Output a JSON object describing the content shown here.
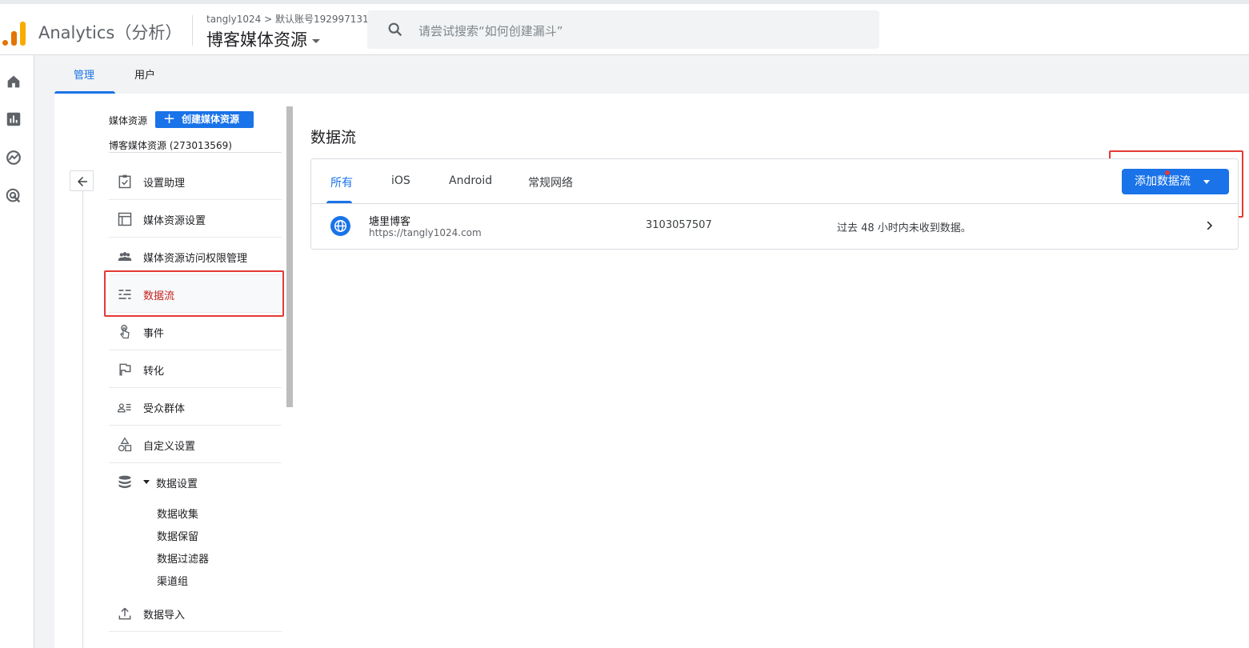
{
  "header": {
    "app_title": "Analytics（分析）",
    "account_crumb": "tangly1024 > 默认账号192997131",
    "property_name": "博客媒体资源",
    "search_placeholder": "请尝试搜索“如何创建漏斗”"
  },
  "rail": {
    "icons": [
      "home-icon",
      "reports-icon",
      "explore-icon",
      "advertising-icon"
    ]
  },
  "admin_tabs": {
    "items": [
      {
        "label": "管理",
        "active": true
      },
      {
        "label": "用户",
        "active": false
      }
    ]
  },
  "left_panel": {
    "section_label": "媒体资源",
    "create_button": "创建媒体资源",
    "property_selector": "博客媒体资源 (273013569)",
    "nav_items": [
      {
        "label": "设置助理",
        "icon": "clipboard-check-icon"
      },
      {
        "label": "媒体资源设置",
        "icon": "property-settings-icon"
      },
      {
        "label": "媒体资源访问权限管理",
        "icon": "people-icon"
      },
      {
        "label": "数据流",
        "icon": "data-streams-icon",
        "active": true
      },
      {
        "label": "事件",
        "icon": "touch-icon"
      },
      {
        "label": "转化",
        "icon": "flag-icon"
      },
      {
        "label": "受众群体",
        "icon": "audience-icon"
      },
      {
        "label": "自定义设置",
        "icon": "shapes-icon"
      },
      {
        "label": "数据设置",
        "icon": "database-icon",
        "expanded": true
      }
    ],
    "data_settings_sub": [
      "数据收集",
      "数据保留",
      "数据过滤器",
      "渠道组"
    ],
    "import_item": {
      "label": "数据导入",
      "icon": "upload-icon"
    }
  },
  "main": {
    "title": "数据流",
    "tabs": [
      {
        "label": "所有",
        "active": true
      },
      {
        "label": "iOS"
      },
      {
        "label": "Android"
      },
      {
        "label": "常规网络"
      }
    ],
    "add_button": "添加数据流",
    "streams": [
      {
        "name": "塘里博客",
        "url": "https://tangly1024.com",
        "id": "3103057507",
        "status": "过去 48 小时内未收到数据。"
      }
    ]
  },
  "colors": {
    "accent": "#1a73e8",
    "highlight": "#e53935",
    "logo_orange": "#f9ab00"
  }
}
